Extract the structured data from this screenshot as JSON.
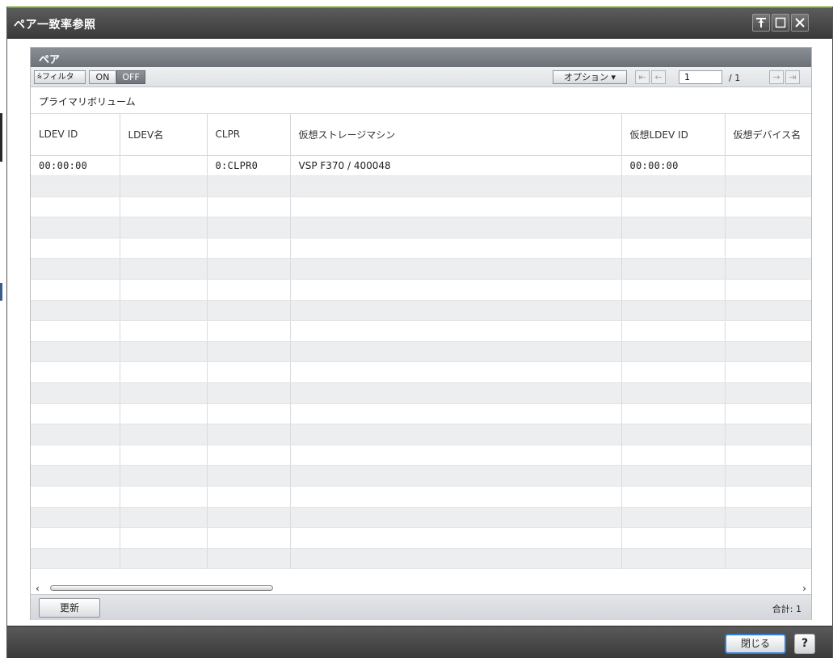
{
  "window": {
    "title": "ペア一致率参照"
  },
  "panel": {
    "title": "ペア",
    "group_label": "プライマリボリューム"
  },
  "toolbar": {
    "filter_label": "⩯フィルタ",
    "filter_on": "ON",
    "filter_off": "OFF",
    "option_label": "オプション ▾",
    "page_current": "1",
    "page_total": "/ 1"
  },
  "table": {
    "columns": [
      "LDEV ID",
      "LDEV名",
      "CLPR",
      "仮想ストレージマシン",
      "仮想LDEV ID",
      "仮想デバイス名"
    ],
    "rows": [
      {
        "ldev_id": "00:00:00",
        "ldev_name": "",
        "clpr": "0:CLPR0",
        "virtual_storage": "VSP F370 / 400048",
        "virtual_ldev_id": "00:00:00",
        "virtual_device_name": ""
      }
    ],
    "empty_rows": 19
  },
  "footer": {
    "refresh_label": "更新",
    "total_label": "合計:  1"
  },
  "dialog": {
    "close_label": "閉じる",
    "help_label": "?"
  },
  "colors": {
    "accent": "#6ea81c",
    "titlebar": "#4a4a4a",
    "focus": "#2f7fd6"
  }
}
